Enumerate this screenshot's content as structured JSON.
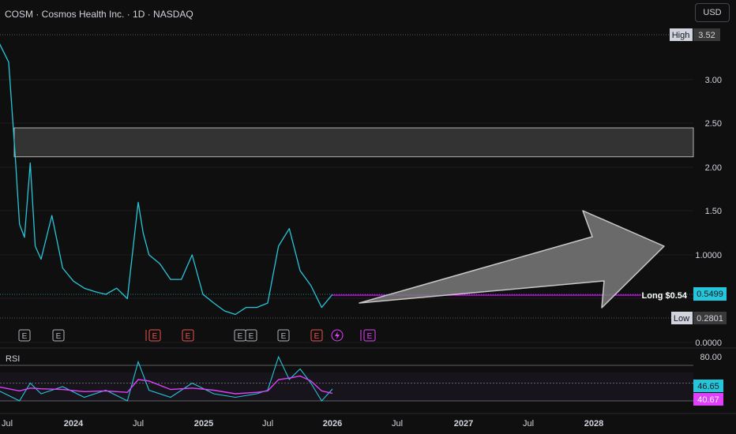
{
  "header": {
    "title": "COSM · Cosmos Health Inc. · 1D · NASDAQ",
    "currency": "USD"
  },
  "price_scale": {
    "ticks": [
      "3.00",
      "2.50",
      "2.00",
      "1.50",
      "1.0000",
      "0.0000"
    ],
    "high_label": "High",
    "high_value": "3.52",
    "low_label": "Low",
    "low_value": "0.2801",
    "last_price": "0.5499",
    "long_label": "Long $0.54"
  },
  "rsi": {
    "label": "RSI",
    "upper_tick": "80.00",
    "value_rsi": "46.65",
    "value_ma": "40.67"
  },
  "time_axis": [
    "Jul",
    "2024",
    "Jul",
    "2025",
    "Jul",
    "2026",
    "Jul",
    "2027",
    "Jul",
    "2028"
  ],
  "earnings_markers": [
    "E",
    "E",
    "E",
    "E",
    "E",
    "E",
    "E",
    "E",
    "E"
  ],
  "colors": {
    "price_line": "#26c6da",
    "rsi_line": "#26c6da",
    "rsi_ma": "#e040fb",
    "long_line": "#d500f9",
    "zone": "#3a3a3a",
    "arrow": "#9e9e9e"
  },
  "chart_data": {
    "type": "line",
    "x_range": [
      "2023-06",
      "2028-12"
    ],
    "ylim": [
      0,
      3.6
    ],
    "high": 3.52,
    "low": 0.2801,
    "last": 0.5499,
    "resistance_zone": [
      2.12,
      2.45
    ],
    "long_entry": 0.54,
    "price_series": {
      "x": [
        "2023-06",
        "2023-07",
        "2023-07-20",
        "2023-08",
        "2023-08-15",
        "2023-09",
        "2023-09-15",
        "2023-10",
        "2023-11",
        "2023-12",
        "2024-01",
        "2024-02",
        "2024-03",
        "2024-04",
        "2024-05",
        "2024-06",
        "2024-07",
        "2024-07-15",
        "2024-08",
        "2024-09",
        "2024-10",
        "2024-11",
        "2024-12",
        "2025-01",
        "2025-02",
        "2025-03",
        "2025-04",
        "2025-05",
        "2025-06",
        "2025-07",
        "2025-08",
        "2025-09",
        "2025-09-20",
        "2025-10",
        "2025-11",
        "2025-12",
        "2026-01"
      ],
      "y": [
        3.45,
        3.2,
        2.1,
        1.35,
        1.2,
        2.05,
        1.1,
        0.95,
        1.45,
        0.85,
        0.7,
        0.62,
        0.58,
        0.55,
        0.62,
        0.5,
        1.6,
        1.25,
        1.0,
        0.9,
        0.72,
        0.72,
        1.0,
        0.55,
        0.45,
        0.36,
        0.32,
        0.4,
        0.4,
        0.45,
        1.1,
        1.3,
        1.0,
        0.82,
        0.65,
        0.4,
        0.55
      ]
    },
    "rsi_series": {
      "ylim": [
        0,
        100
      ],
      "x": [
        "2023-06",
        "2023-08",
        "2023-09",
        "2023-10",
        "2023-12",
        "2024-02",
        "2024-04",
        "2024-06",
        "2024-07",
        "2024-08",
        "2024-10",
        "2024-12",
        "2025-02",
        "2025-04",
        "2025-06",
        "2025-07",
        "2025-08",
        "2025-09",
        "2025-10",
        "2025-11",
        "2025-12",
        "2026-01"
      ],
      "rsi": [
        45,
        30,
        55,
        40,
        50,
        35,
        45,
        30,
        85,
        45,
        35,
        55,
        40,
        35,
        40,
        45,
        92,
        60,
        75,
        55,
        30,
        46.65
      ],
      "ma": [
        50,
        44,
        48,
        47,
        46,
        43,
        44,
        42,
        60,
        58,
        46,
        48,
        45,
        40,
        42,
        44,
        60,
        62,
        65,
        58,
        44,
        40.67
      ]
    }
  }
}
